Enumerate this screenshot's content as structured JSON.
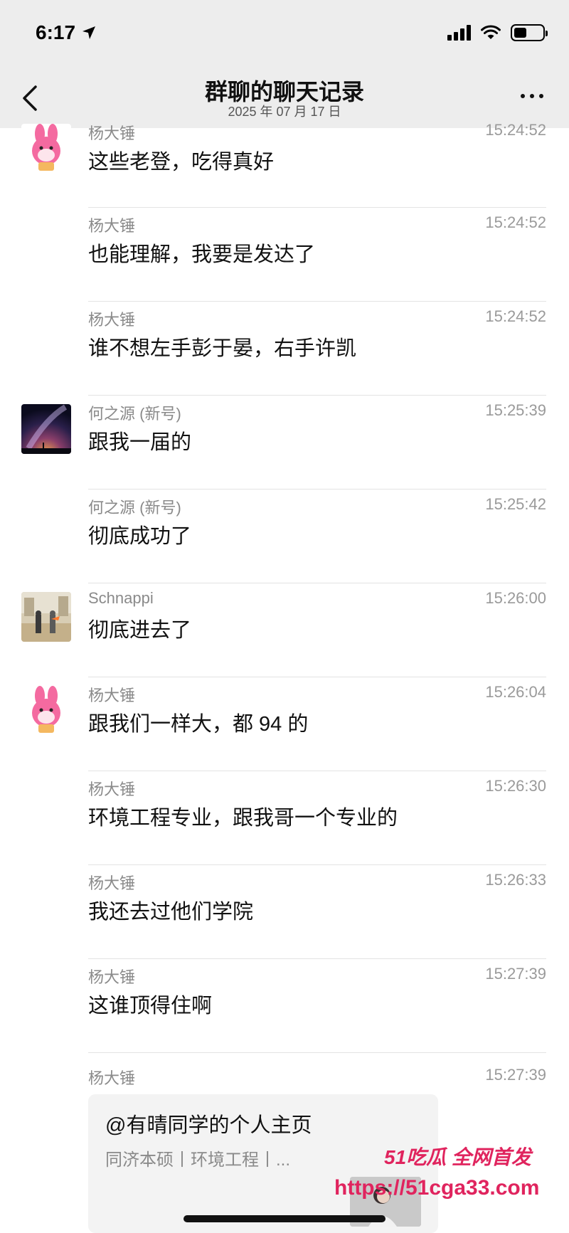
{
  "status_bar": {
    "time": "6:17"
  },
  "header": {
    "title": "群聊的聊天记录",
    "date": "2025 年 07 月 17 日"
  },
  "messages": [
    {
      "sender": "杨大锤",
      "time": "15:24:52",
      "text": "这些老登，吃得真好",
      "avatar": "pink-bunny"
    },
    {
      "sender": "杨大锤",
      "time": "15:24:52",
      "text": "也能理解，我要是发达了",
      "avatar": ""
    },
    {
      "sender": "杨大锤",
      "time": "15:24:52",
      "text": "谁不想左手彭于晏，右手许凯",
      "avatar": ""
    },
    {
      "sender": "何之源 (新号)",
      "time": "15:25:39",
      "text": "跟我一届的",
      "avatar": "galaxy"
    },
    {
      "sender": "何之源 (新号)",
      "time": "15:25:42",
      "text": "彻底成功了",
      "avatar": ""
    },
    {
      "sender": "Schnappi",
      "time": "15:26:00",
      "text": "彻底进去了",
      "avatar": "handshake-photo"
    },
    {
      "sender": "杨大锤",
      "time": "15:26:04",
      "text": "跟我们一样大，都 94 的",
      "avatar": "pink-bunny"
    },
    {
      "sender": "杨大锤",
      "time": "15:26:30",
      "text": "环境工程专业，跟我哥一个专业的",
      "avatar": ""
    },
    {
      "sender": "杨大锤",
      "time": "15:26:33",
      "text": "我还去过他们学院",
      "avatar": ""
    },
    {
      "sender": "杨大锤",
      "time": "15:27:39",
      "text": "这谁顶得住啊",
      "avatar": ""
    }
  ],
  "last_message": {
    "sender": "杨大锤",
    "time": "15:27:39",
    "card_title": "@有晴同学的个人主页",
    "card_desc": "同济本硕丨环境工程丨..."
  },
  "watermark": {
    "top": "51吃瓜 全网首发",
    "bottom": "https://51cga33.com"
  },
  "colors": {
    "header_bg": "#ededed",
    "accent": "#e0245e"
  }
}
